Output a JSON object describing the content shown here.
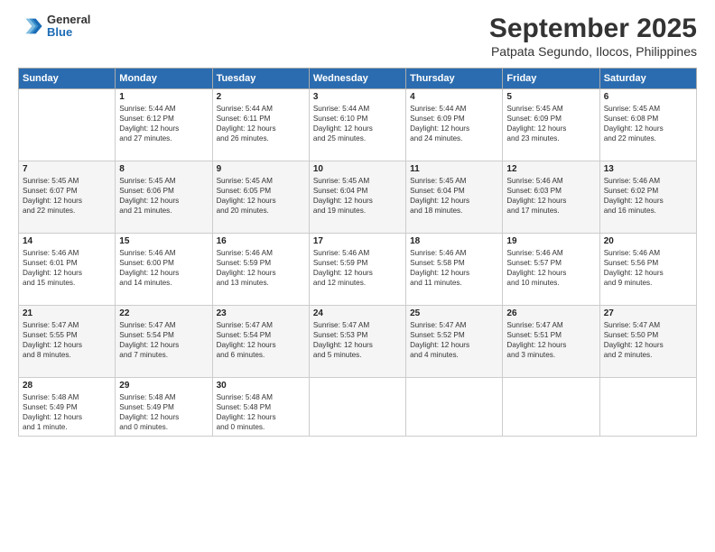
{
  "logo": {
    "general": "General",
    "blue": "Blue"
  },
  "header": {
    "title": "September 2025",
    "subtitle": "Patpata Segundo, Ilocos, Philippines"
  },
  "days_of_week": [
    "Sunday",
    "Monday",
    "Tuesday",
    "Wednesday",
    "Thursday",
    "Friday",
    "Saturday"
  ],
  "weeks": [
    [
      {
        "day": "",
        "info": ""
      },
      {
        "day": "1",
        "info": "Sunrise: 5:44 AM\nSunset: 6:12 PM\nDaylight: 12 hours\nand 27 minutes."
      },
      {
        "day": "2",
        "info": "Sunrise: 5:44 AM\nSunset: 6:11 PM\nDaylight: 12 hours\nand 26 minutes."
      },
      {
        "day": "3",
        "info": "Sunrise: 5:44 AM\nSunset: 6:10 PM\nDaylight: 12 hours\nand 25 minutes."
      },
      {
        "day": "4",
        "info": "Sunrise: 5:44 AM\nSunset: 6:09 PM\nDaylight: 12 hours\nand 24 minutes."
      },
      {
        "day": "5",
        "info": "Sunrise: 5:45 AM\nSunset: 6:09 PM\nDaylight: 12 hours\nand 23 minutes."
      },
      {
        "day": "6",
        "info": "Sunrise: 5:45 AM\nSunset: 6:08 PM\nDaylight: 12 hours\nand 22 minutes."
      }
    ],
    [
      {
        "day": "7",
        "info": "Sunrise: 5:45 AM\nSunset: 6:07 PM\nDaylight: 12 hours\nand 22 minutes."
      },
      {
        "day": "8",
        "info": "Sunrise: 5:45 AM\nSunset: 6:06 PM\nDaylight: 12 hours\nand 21 minutes."
      },
      {
        "day": "9",
        "info": "Sunrise: 5:45 AM\nSunset: 6:05 PM\nDaylight: 12 hours\nand 20 minutes."
      },
      {
        "day": "10",
        "info": "Sunrise: 5:45 AM\nSunset: 6:04 PM\nDaylight: 12 hours\nand 19 minutes."
      },
      {
        "day": "11",
        "info": "Sunrise: 5:45 AM\nSunset: 6:04 PM\nDaylight: 12 hours\nand 18 minutes."
      },
      {
        "day": "12",
        "info": "Sunrise: 5:46 AM\nSunset: 6:03 PM\nDaylight: 12 hours\nand 17 minutes."
      },
      {
        "day": "13",
        "info": "Sunrise: 5:46 AM\nSunset: 6:02 PM\nDaylight: 12 hours\nand 16 minutes."
      }
    ],
    [
      {
        "day": "14",
        "info": "Sunrise: 5:46 AM\nSunset: 6:01 PM\nDaylight: 12 hours\nand 15 minutes."
      },
      {
        "day": "15",
        "info": "Sunrise: 5:46 AM\nSunset: 6:00 PM\nDaylight: 12 hours\nand 14 minutes."
      },
      {
        "day": "16",
        "info": "Sunrise: 5:46 AM\nSunset: 5:59 PM\nDaylight: 12 hours\nand 13 minutes."
      },
      {
        "day": "17",
        "info": "Sunrise: 5:46 AM\nSunset: 5:59 PM\nDaylight: 12 hours\nand 12 minutes."
      },
      {
        "day": "18",
        "info": "Sunrise: 5:46 AM\nSunset: 5:58 PM\nDaylight: 12 hours\nand 11 minutes."
      },
      {
        "day": "19",
        "info": "Sunrise: 5:46 AM\nSunset: 5:57 PM\nDaylight: 12 hours\nand 10 minutes."
      },
      {
        "day": "20",
        "info": "Sunrise: 5:46 AM\nSunset: 5:56 PM\nDaylight: 12 hours\nand 9 minutes."
      }
    ],
    [
      {
        "day": "21",
        "info": "Sunrise: 5:47 AM\nSunset: 5:55 PM\nDaylight: 12 hours\nand 8 minutes."
      },
      {
        "day": "22",
        "info": "Sunrise: 5:47 AM\nSunset: 5:54 PM\nDaylight: 12 hours\nand 7 minutes."
      },
      {
        "day": "23",
        "info": "Sunrise: 5:47 AM\nSunset: 5:54 PM\nDaylight: 12 hours\nand 6 minutes."
      },
      {
        "day": "24",
        "info": "Sunrise: 5:47 AM\nSunset: 5:53 PM\nDaylight: 12 hours\nand 5 minutes."
      },
      {
        "day": "25",
        "info": "Sunrise: 5:47 AM\nSunset: 5:52 PM\nDaylight: 12 hours\nand 4 minutes."
      },
      {
        "day": "26",
        "info": "Sunrise: 5:47 AM\nSunset: 5:51 PM\nDaylight: 12 hours\nand 3 minutes."
      },
      {
        "day": "27",
        "info": "Sunrise: 5:47 AM\nSunset: 5:50 PM\nDaylight: 12 hours\nand 2 minutes."
      }
    ],
    [
      {
        "day": "28",
        "info": "Sunrise: 5:48 AM\nSunset: 5:49 PM\nDaylight: 12 hours\nand 1 minute."
      },
      {
        "day": "29",
        "info": "Sunrise: 5:48 AM\nSunset: 5:49 PM\nDaylight: 12 hours\nand 0 minutes."
      },
      {
        "day": "30",
        "info": "Sunrise: 5:48 AM\nSunset: 5:48 PM\nDaylight: 12 hours\nand 0 minutes."
      },
      {
        "day": "",
        "info": ""
      },
      {
        "day": "",
        "info": ""
      },
      {
        "day": "",
        "info": ""
      },
      {
        "day": "",
        "info": ""
      }
    ]
  ]
}
